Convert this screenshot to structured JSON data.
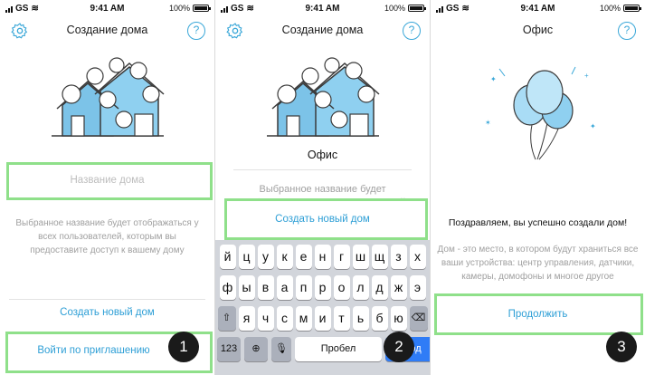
{
  "status": {
    "carrier": "GS",
    "time": "9:41 AM",
    "battery": "100%"
  },
  "screen1": {
    "title": "Создание дома",
    "name_placeholder": "Название дома",
    "hint": "Выбранное название будет отображаться у всех пользователей, которым вы предоставите доступ к вашему дому",
    "create_label": "Создать новый дом",
    "invite_label": "Войти по приглашению",
    "step": "1"
  },
  "screen2": {
    "title": "Создание дома",
    "name_value": "Офис",
    "hint": "Выбранное название будет отображаться у всех пользователей",
    "create_label": "Создать новый дом",
    "keyboard": {
      "row1": [
        "й",
        "ц",
        "у",
        "к",
        "е",
        "н",
        "г",
        "ш",
        "щ",
        "з",
        "х"
      ],
      "row2": [
        "ф",
        "ы",
        "в",
        "а",
        "п",
        "р",
        "о",
        "л",
        "д",
        "ж",
        "э"
      ],
      "row3": [
        "я",
        "ч",
        "с",
        "м",
        "и",
        "т",
        "ь",
        "б",
        "ю"
      ],
      "num_key": "123",
      "space_label": "Пробел",
      "go_label": "Ввод"
    },
    "step": "2"
  },
  "screen3": {
    "title": "Офис",
    "congrats": "Поздравляем, вы успешно создали дом!",
    "description": "Дом - это место, в котором будут храниться все ваши устройства: центр управления, датчики, камеры, домофоны и многое другое",
    "continue_label": "Продолжить",
    "step": "3"
  },
  "colors": {
    "accent": "#2e9fd6",
    "highlight": "#8fe08a",
    "badge": "#1a1a1a"
  }
}
